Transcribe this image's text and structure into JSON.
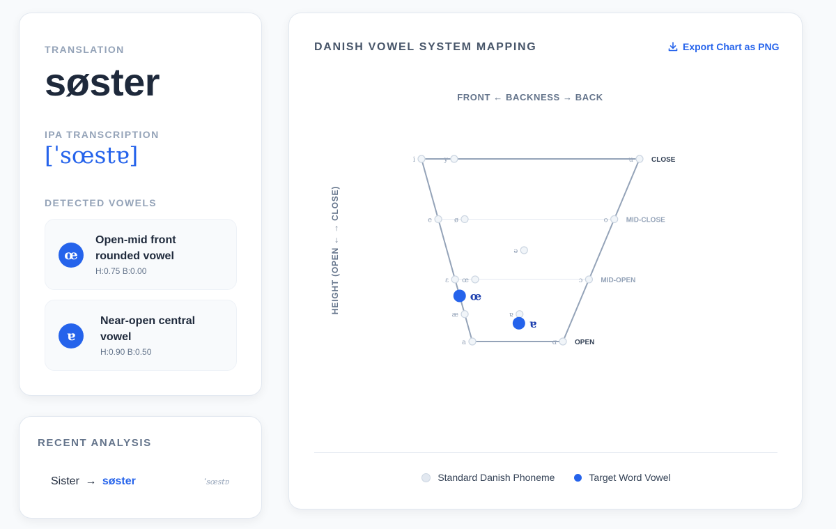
{
  "translation": {
    "label": "TRANSLATION",
    "word": "søster",
    "ipa_label": "IPA TRANSCRIPTION",
    "ipa": "[ˈsœstɐ]",
    "detected_label": "DETECTED VOWELS"
  },
  "detected_vowels": [
    {
      "symbol": "œ",
      "name": "Open-mid front rounded vowel",
      "coords": "H:0.75 B:0.00"
    },
    {
      "symbol": "ɐ",
      "name": "Near-open central vowel",
      "coords": "H:0.90 B:0.50"
    }
  ],
  "recent": {
    "title": "RECENT ANALYSIS",
    "source": "Sister",
    "arrow": "→",
    "target": "søster",
    "ipa": "ˈsœstɐ"
  },
  "chart": {
    "title": "DANISH VOWEL SYSTEM MAPPING",
    "export_label": "Export Chart as PNG",
    "legend_standard": "Standard Danish Phoneme",
    "legend_target": "Target Word Vowel"
  },
  "colors": {
    "accent": "#2563eb",
    "standard_dot": "#e2e8f0",
    "trapezoid": "#94a3b8"
  },
  "chart_data": {
    "type": "scatter",
    "xlabel": "FRONT ← BACKNESS → BACK",
    "ylabel": "HEIGHT (OPEN ← → CLOSE)",
    "height_levels": [
      {
        "label": "CLOSE",
        "value": 0.0
      },
      {
        "label": "MID-CLOSE",
        "value": 0.33
      },
      {
        "label": "MID-OPEN",
        "value": 0.66
      },
      {
        "label": "OPEN",
        "value": 1.0
      }
    ],
    "standard_phonemes": [
      {
        "symbol": "i",
        "height": 0.0,
        "backness": 0.0
      },
      {
        "symbol": "y",
        "height": 0.0,
        "backness": 0.15
      },
      {
        "symbol": "u",
        "height": 0.0,
        "backness": 1.0
      },
      {
        "symbol": "e",
        "height": 0.33,
        "backness": 0.0
      },
      {
        "symbol": "ø",
        "height": 0.33,
        "backness": 0.15
      },
      {
        "symbol": "o",
        "height": 0.33,
        "backness": 1.0
      },
      {
        "symbol": "ə",
        "height": 0.5,
        "backness": 0.5
      },
      {
        "symbol": "ɛ",
        "height": 0.66,
        "backness": 0.0
      },
      {
        "symbol": "œ",
        "height": 0.66,
        "backness": 0.15
      },
      {
        "symbol": "ɔ",
        "height": 0.66,
        "backness": 1.0
      },
      {
        "symbol": "æ",
        "height": 0.85,
        "backness": 0.0
      },
      {
        "symbol": "ɐ",
        "height": 0.85,
        "backness": 0.5
      },
      {
        "symbol": "a",
        "height": 1.0,
        "backness": 0.0
      },
      {
        "symbol": "ɑ",
        "height": 1.0,
        "backness": 1.0
      }
    ],
    "target_vowels": [
      {
        "symbol": "œ",
        "height": 0.75,
        "backness": 0.0
      },
      {
        "symbol": "ɐ",
        "height": 0.9,
        "backness": 0.5
      }
    ]
  }
}
